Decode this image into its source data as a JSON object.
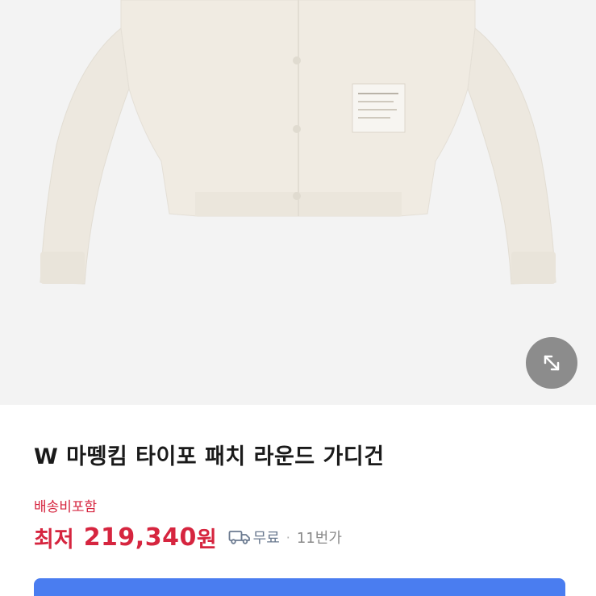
{
  "product": {
    "title": "W 마뗑킴 타이포 패치 라운드 가디건",
    "image": "beige-round-neck-cardigan-photo"
  },
  "pricing": {
    "shipping_note": "배송비포함",
    "label": "최저",
    "price": "219,340",
    "unit": "원",
    "shipping_badge": "무료",
    "separator": "·",
    "seller": "11번가"
  },
  "icons": {
    "expand": "expand-arrows-icon",
    "truck": "delivery-truck-icon"
  },
  "colors": {
    "price_red": "#d6253f",
    "button_blue": "#4a7df0",
    "image_background": "#f3f3f3"
  }
}
